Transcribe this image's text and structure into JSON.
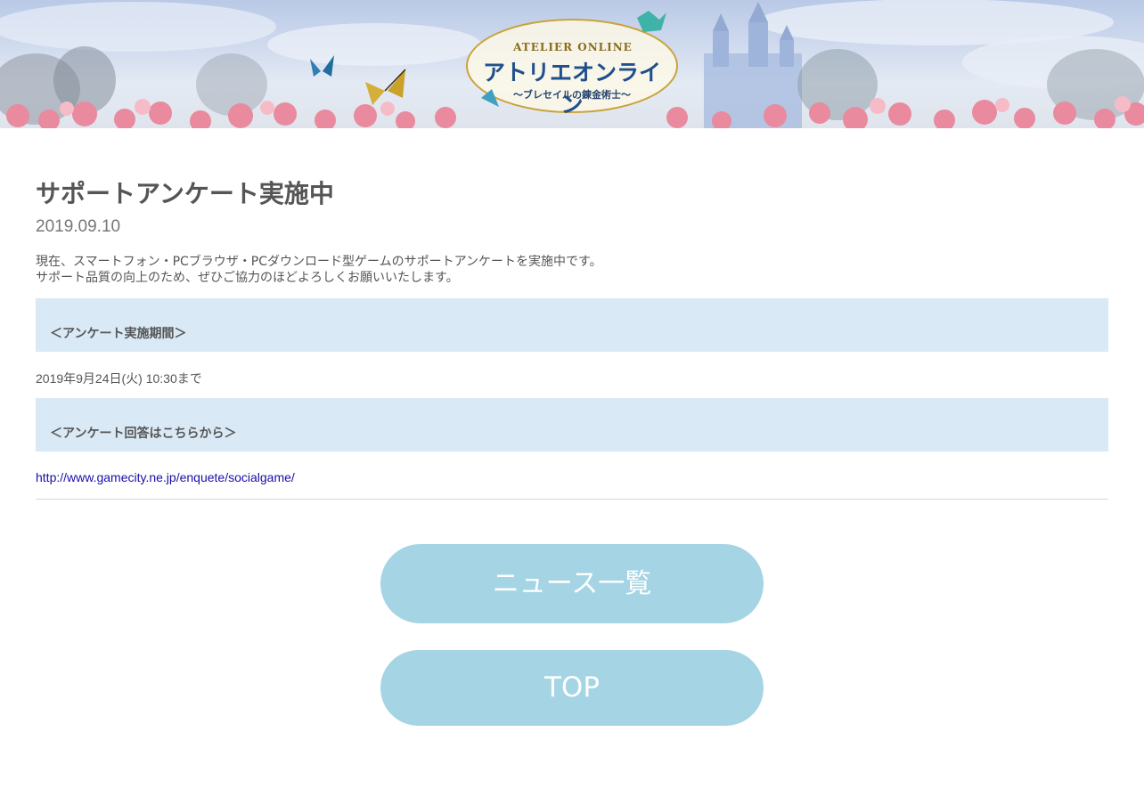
{
  "header": {
    "logo_text_en": "ATELIER ONLINE",
    "logo_text_jp": "アトリエオンライン",
    "logo_subtitle": "～ブレセイルの錬金術士～"
  },
  "article": {
    "title": "サポートアンケート実施中",
    "date": "2019.09.10",
    "intro_line1": "現在、スマートフォン・PCブラウザ・PCダウンロード型ゲームのサポートアンケートを実施中です。",
    "intro_line2": "サポート品質の向上のため、ぜひご協力のほどよろしくお願いいたします。",
    "period_heading": "＜アンケート実施期間＞",
    "period_value": "2019年9月24日(火) 10:30まで",
    "answer_heading": "＜アンケート回答はこちらから＞",
    "answer_link": "http://www.gamecity.ne.jp/enquete/socialgame/"
  },
  "buttons": {
    "news_list": "ニュース一覧",
    "top": "TOP"
  },
  "colors": {
    "section_bg": "#d9e9f5",
    "button_bg": "#a5d4e4",
    "link": "#1a0dab"
  }
}
